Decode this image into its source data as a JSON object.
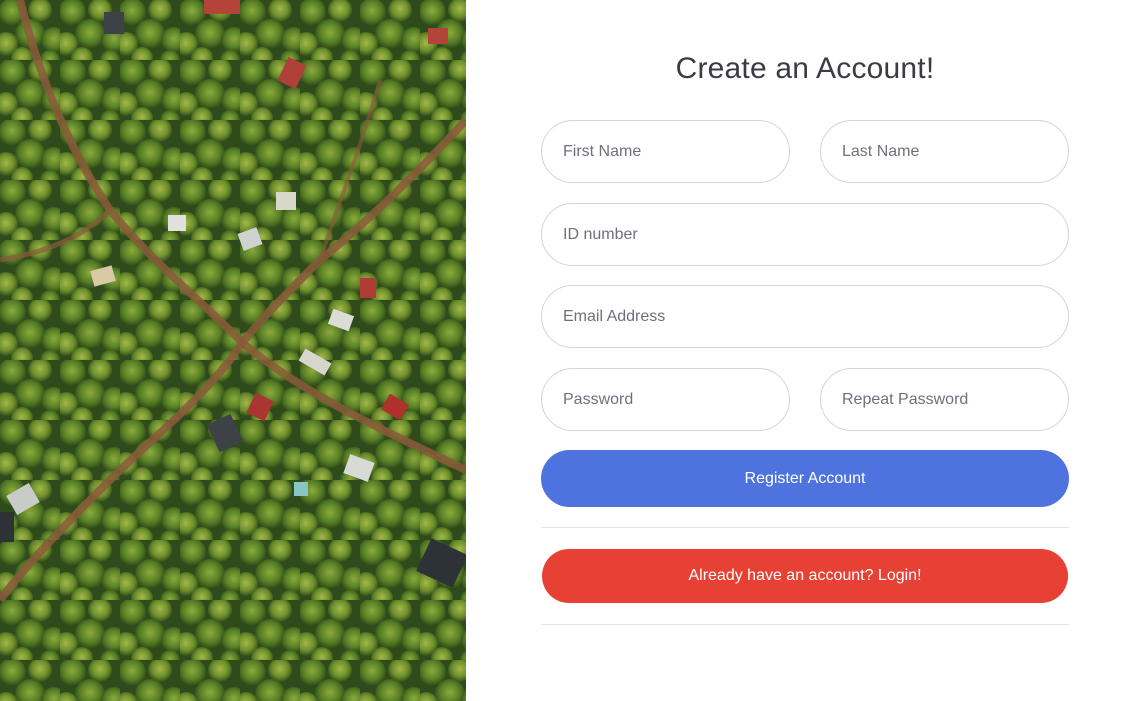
{
  "hero": {
    "alt": "aerial view of forest with houses and roads"
  },
  "form": {
    "title": "Create an Account!",
    "first_name": {
      "placeholder": "First Name",
      "value": ""
    },
    "last_name": {
      "placeholder": "Last Name",
      "value": ""
    },
    "id_number": {
      "placeholder": "ID number",
      "value": ""
    },
    "email": {
      "placeholder": "Email Address",
      "value": ""
    },
    "password": {
      "placeholder": "Password",
      "value": ""
    },
    "repeat_password": {
      "placeholder": "Repeat Password",
      "value": ""
    },
    "register_label": "Register Account",
    "login_label": "Already have an account? Login!"
  },
  "colors": {
    "primary": "#4e73df",
    "danger": "#e74135",
    "input_border": "#d1d3e2",
    "placeholder": "#6e707e",
    "title": "#3a3b45"
  }
}
